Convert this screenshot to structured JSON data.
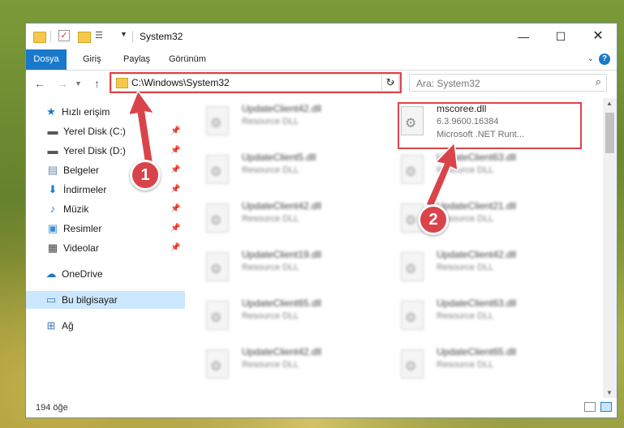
{
  "window": {
    "title": "System32"
  },
  "ribbon": {
    "tabs": [
      "Dosya",
      "Giriş",
      "Paylaş",
      "Görünüm"
    ],
    "help": "?"
  },
  "address": {
    "path": "C:\\Windows\\System32"
  },
  "search": {
    "placeholder": "Ara: System32"
  },
  "nav": {
    "quick_access": "Hızlı erişim",
    "items": [
      {
        "label": "Yerel Disk (C:)",
        "icon": "drive-icon"
      },
      {
        "label": "Yerel Disk (D:)",
        "icon": "drive-icon"
      },
      {
        "label": "Belgeler",
        "icon": "documents-icon"
      },
      {
        "label": "İndirmeler",
        "icon": "downloads-icon"
      },
      {
        "label": "Müzik",
        "icon": "music-icon"
      },
      {
        "label": "Resimler",
        "icon": "pictures-icon"
      },
      {
        "label": "Videolar",
        "icon": "videos-icon"
      }
    ],
    "onedrive": "OneDrive",
    "this_pc": "Bu bilgisayar",
    "network": "Ağ"
  },
  "files": {
    "highlighted": {
      "name": "mscoree.dll",
      "version": "6.3.9600.16384",
      "description": "Microsoft .NET Runt..."
    },
    "left": [
      {
        "name": "UpdateClient42.dll",
        "type": "Resource DLL"
      },
      {
        "name": "UpdateClient5.dll",
        "type": "Resource DLL"
      },
      {
        "name": "UpdateClient42.dll",
        "type": "Resource DLL"
      },
      {
        "name": "UpdateClient19.dll",
        "type": "Resource DLL"
      },
      {
        "name": "UpdateClient65.dll",
        "type": "Resource DLL"
      },
      {
        "name": "UpdateClient42.dll",
        "type": "Resource DLL"
      }
    ],
    "right": [
      {
        "name": "UpdateClient63.dll",
        "type": "Resource DLL"
      },
      {
        "name": "UpdateClient21.dll",
        "type": "Resource DLL"
      },
      {
        "name": "UpdateClient42.dll",
        "type": "Resource DLL"
      },
      {
        "name": "UpdateClient63.dll",
        "type": "Resource DLL"
      },
      {
        "name": "UpdateClient65.dll",
        "type": "Resource DLL"
      }
    ]
  },
  "status": {
    "count": "194 öğe"
  },
  "callouts": [
    "1",
    "2"
  ],
  "colors": {
    "accent": "#1979ca",
    "highlight": "#d9444b",
    "selected": "#cce8ff"
  }
}
